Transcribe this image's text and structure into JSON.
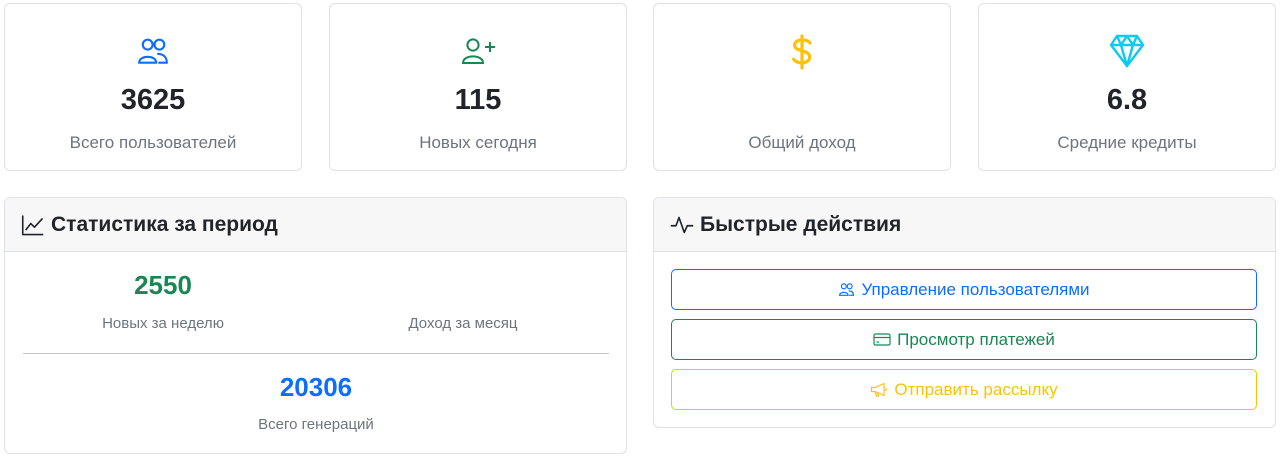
{
  "stats": [
    {
      "icon": "users-icon",
      "value": "3625",
      "label": "Всего пользователей",
      "color": "#0d6efd"
    },
    {
      "icon": "user-plus-icon",
      "value": "115",
      "label": "Новых сегодня",
      "color": "#198754"
    },
    {
      "icon": "dollar-icon",
      "value": "",
      "label": "Общий доход",
      "color": "#ffc107"
    },
    {
      "icon": "gem-icon",
      "value": "6.8",
      "label": "Средние кредиты",
      "color": "#0dcaf0"
    }
  ],
  "period_stats": {
    "title": "Статистика за период",
    "icon": "graph-up-icon",
    "weekly_value": "2550",
    "weekly_label": "Новых за неделю",
    "monthly_value": "",
    "monthly_label": "Доход за месяц",
    "total_value": "20306",
    "total_label": "Всего генераций",
    "colors": {
      "weekly": "#198754",
      "total": "#0d6efd"
    }
  },
  "quick_actions": {
    "title": "Быстрые действия",
    "icon": "activity-icon",
    "buttons": [
      {
        "icon": "users-icon",
        "label": "Управление пользователями",
        "color": "#0d6efd"
      },
      {
        "icon": "credit-card-icon",
        "label": "Просмотр платежей",
        "color": "#198754"
      },
      {
        "icon": "megaphone-icon",
        "label": "Отправить рассылку",
        "color": "#ffc107"
      }
    ]
  }
}
